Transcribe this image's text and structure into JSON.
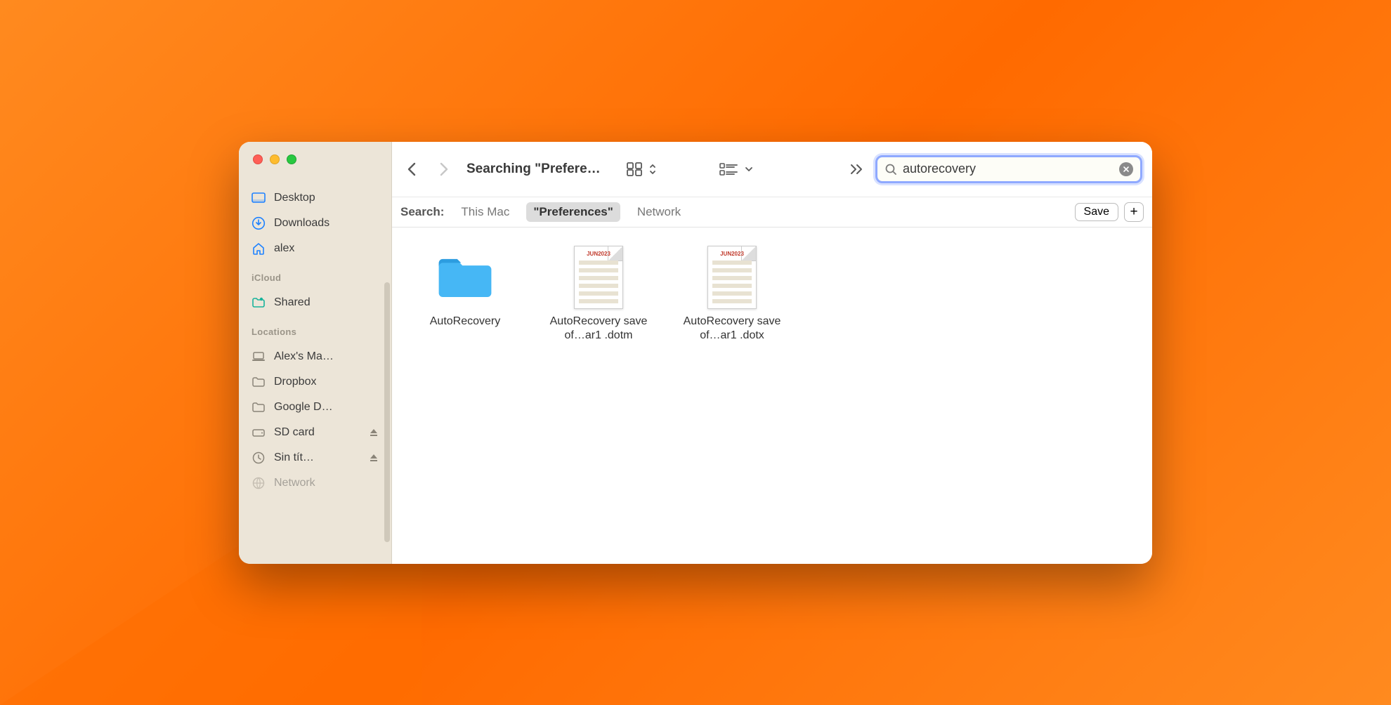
{
  "window": {
    "title": "Searching \"Prefere…"
  },
  "sidebar": {
    "favorites": [
      {
        "icon": "desktop",
        "label": "Desktop"
      },
      {
        "icon": "downloads",
        "label": "Downloads"
      },
      {
        "icon": "home",
        "label": "alex"
      }
    ],
    "icloud_heading": "iCloud",
    "icloud": [
      {
        "icon": "shared",
        "label": "Shared"
      }
    ],
    "locations_heading": "Locations",
    "locations": [
      {
        "icon": "laptop",
        "label": "Alex's Ma…",
        "eject": false
      },
      {
        "icon": "folder",
        "label": "Dropbox",
        "eject": false
      },
      {
        "icon": "folder",
        "label": "Google D…",
        "eject": false
      },
      {
        "icon": "disk",
        "label": "SD card",
        "eject": true
      },
      {
        "icon": "time",
        "label": "Sin tít…",
        "eject": true
      },
      {
        "icon": "globe",
        "label": "Network",
        "eject": false
      }
    ]
  },
  "toolbar": {
    "search_value": "autorecovery"
  },
  "scopebar": {
    "label": "Search:",
    "options": [
      "This Mac",
      "\"Preferences\"",
      "Network"
    ],
    "selected_index": 1,
    "save_label": "Save"
  },
  "results": [
    {
      "type": "folder",
      "name": "AutoRecovery"
    },
    {
      "type": "doc",
      "head": "JUN2023",
      "name": "AutoRecovery save of…ar1 .dotm"
    },
    {
      "type": "doc",
      "head": "JUN2023",
      "name": "AutoRecovery save of…ar1 .dotx"
    }
  ]
}
